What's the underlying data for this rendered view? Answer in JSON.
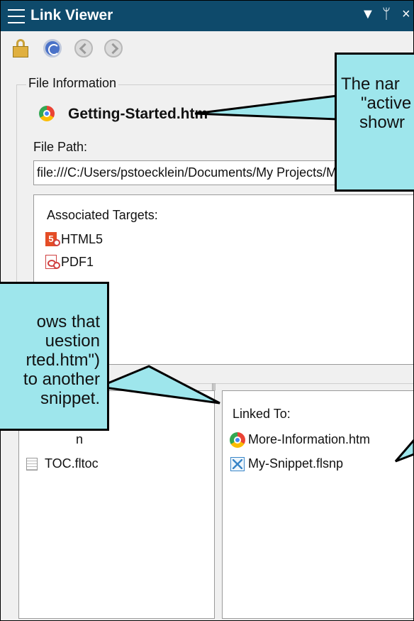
{
  "window": {
    "title": "Link Viewer",
    "controls": [
      "▼",
      "ᛘ",
      "×"
    ]
  },
  "toolbar": {
    "icons": [
      "lock-icon",
      "refresh-icon",
      "back-icon",
      "forward-icon"
    ]
  },
  "file_info": {
    "legend": "File Information",
    "file_name": "Getting-Started.htm",
    "path_label": "File Path:",
    "path_value": "file:///C:/Users/pstoecklein/Documents/My Projects/Mot",
    "targets_label": "Associated Targets:",
    "targets": [
      {
        "label": "HTML5",
        "icon": "html5-target-icon"
      },
      {
        "label": "PDF1",
        "icon": "pdf-target-icon"
      }
    ]
  },
  "linked_from": {
    "items": [
      {
        "label": "n",
        "icon": "file-icon"
      },
      {
        "label": "TOC.fltoc",
        "icon": "toc-icon"
      }
    ]
  },
  "linked_to": {
    "label": "Linked To:",
    "items": [
      {
        "label": "More-Information.htm",
        "icon": "chrome-icon"
      },
      {
        "label": "My-Snippet.flsnp",
        "icon": "snippet-icon"
      }
    ]
  },
  "callouts": {
    "top": [
      "The nar",
      "\"active",
      "showr"
    ],
    "left": [
      "ows that",
      "uestion",
      "rted.htm\")",
      "to another",
      "snippet."
    ]
  },
  "colors": {
    "titlebar": "#0e4a6b",
    "callout_fill": "#9ee6ec",
    "panel_bg": "#f0f0f0"
  }
}
